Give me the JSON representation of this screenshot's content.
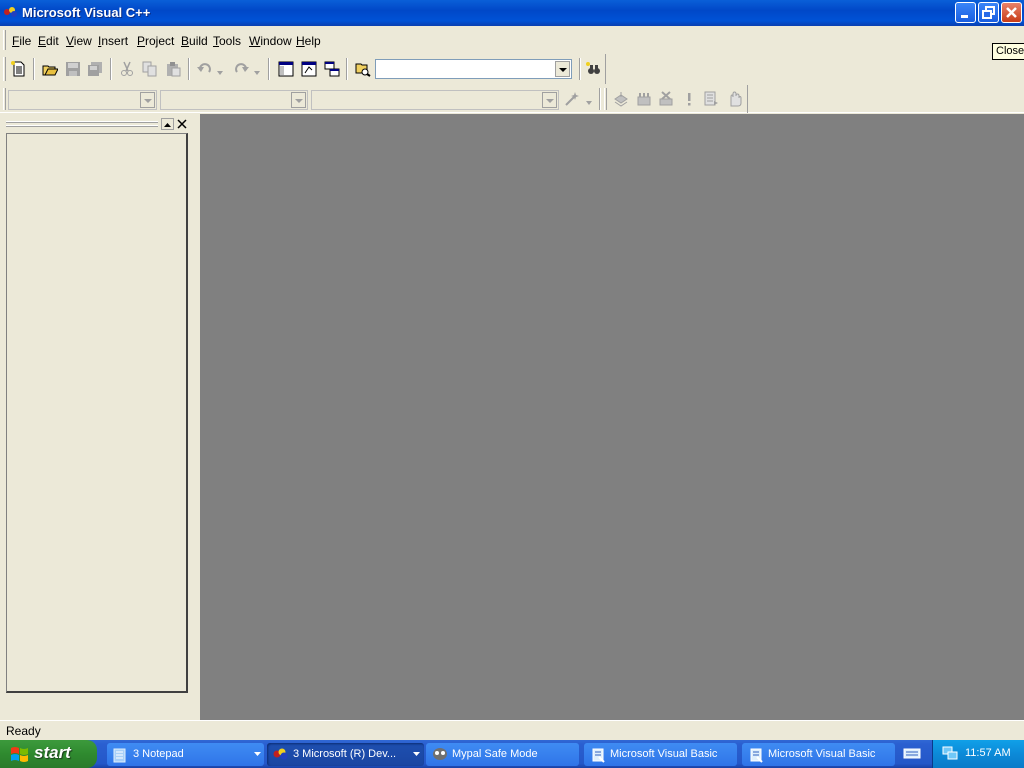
{
  "window": {
    "title": "Microsoft Visual C++"
  },
  "tooltip": {
    "text": "Close"
  },
  "menubar": {
    "items": [
      {
        "label": "File",
        "key": "F",
        "rest": "ile"
      },
      {
        "label": "Edit",
        "key": "E",
        "rest": "dit"
      },
      {
        "label": "View",
        "key": "V",
        "rest": "iew"
      },
      {
        "label": "Insert",
        "key": "I",
        "rest": "nsert"
      },
      {
        "label": "Project",
        "key": "P",
        "rest": "roject"
      },
      {
        "label": "Build",
        "key": "B",
        "rest": "uild"
      },
      {
        "label": "Tools",
        "key": "T",
        "rest": "ools"
      },
      {
        "label": "Window",
        "key": "W",
        "rest": "indow"
      },
      {
        "label": "Help",
        "key": "H",
        "rest": "elp"
      }
    ]
  },
  "toolbar": {
    "find_combo_value": "",
    "icons": [
      "new-text-file-icon",
      "open-icon",
      "save-icon",
      "save-all-icon",
      "cut-icon",
      "copy-icon",
      "paste-icon",
      "undo-icon",
      "redo-icon",
      "workspace-icon",
      "output-icon",
      "window-list-icon",
      "find-in-files-icon",
      "find-icon"
    ]
  },
  "wizardbar": {
    "class_combo": "",
    "filter_combo": "",
    "members_combo": "",
    "icons": [
      "wizard-action-icon",
      "compile-icon",
      "build-icon",
      "stop-build-icon",
      "execute-icon",
      "go-icon",
      "insert-breakpoint-icon"
    ]
  },
  "status": {
    "text": "Ready"
  },
  "taskbar": {
    "start_label": "start",
    "tasks": [
      {
        "label": "3 Notepad",
        "active": false
      },
      {
        "label": "3 Microsoft (R) Dev...",
        "active": true
      },
      {
        "label": "Mypal Safe Mode",
        "active": false
      },
      {
        "label": "Microsoft Visual Basic",
        "active": false
      },
      {
        "label": "Microsoft Visual Basic",
        "active": false
      }
    ],
    "clock": "11:57 AM"
  }
}
